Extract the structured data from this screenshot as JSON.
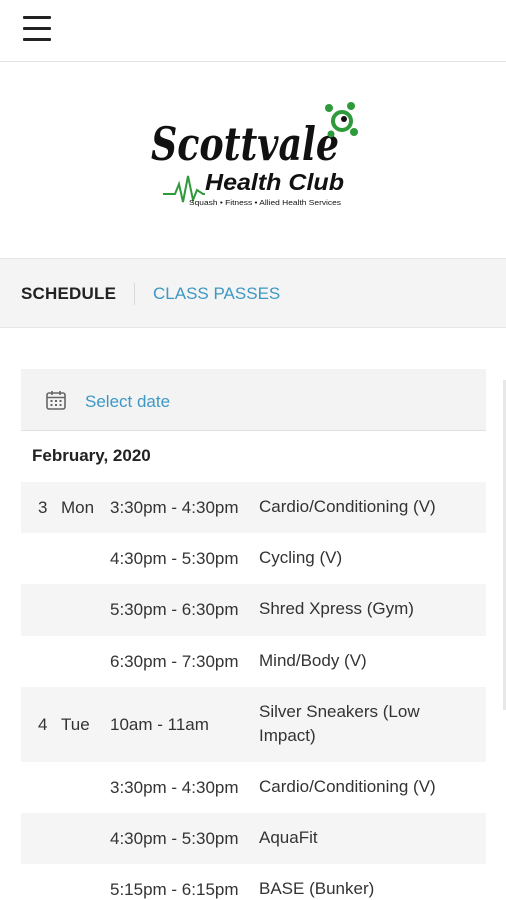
{
  "header": {
    "menu_icon": "hamburger-menu-icon"
  },
  "logo": {
    "line1": "Scottvale",
    "line2": "Health Club",
    "tagline": "Squash • Fitness • Allied Health Services",
    "accent": "#2e9a3a"
  },
  "tabs": [
    {
      "label": "SCHEDULE",
      "active": true
    },
    {
      "label": "CLASS PASSES",
      "active": false
    }
  ],
  "date_picker": {
    "icon": "calendar-icon",
    "label": "Select date"
  },
  "schedule": {
    "month": "February, 2020",
    "rows": [
      {
        "day": "3",
        "dow": "Mon",
        "time": "3:30pm - 4:30pm",
        "class": "Cardio/Conditioning (V)"
      },
      {
        "day": "",
        "dow": "",
        "time": "4:30pm - 5:30pm",
        "class": "Cycling (V)"
      },
      {
        "day": "",
        "dow": "",
        "time": "5:30pm - 6:30pm",
        "class": "Shred Xpress (Gym)"
      },
      {
        "day": "",
        "dow": "",
        "time": "6:30pm - 7:30pm",
        "class": "Mind/Body (V)"
      },
      {
        "day": "4",
        "dow": "Tue",
        "time": "10am - 11am",
        "class": "Silver Sneakers (Low Impact)"
      },
      {
        "day": "",
        "dow": "",
        "time": "3:30pm - 4:30pm",
        "class": "Cardio/Conditioning (V)"
      },
      {
        "day": "",
        "dow": "",
        "time": "4:30pm - 5:30pm",
        "class": "AquaFit"
      },
      {
        "day": "",
        "dow": "",
        "time": "5:15pm - 6:15pm",
        "class": "BASE (Bunker)"
      }
    ]
  },
  "colors": {
    "link": "#3d98c4",
    "row_shade": "#f5f5f5"
  }
}
